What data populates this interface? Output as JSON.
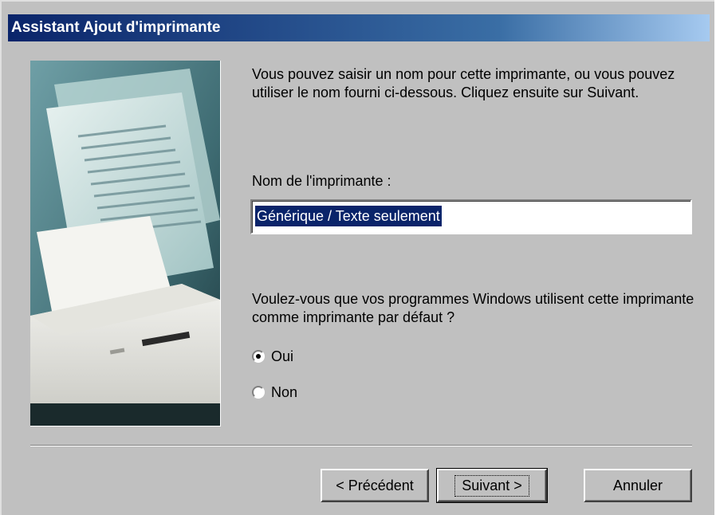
{
  "window": {
    "title": "Assistant Ajout d'imprimante"
  },
  "wizard": {
    "intro": "Vous pouvez saisir un nom pour cette imprimante, ou vous pouvez utiliser le nom fourni ci-dessous. Cliquez ensuite sur Suivant.",
    "printer_name_label": "Nom de l'imprimante :",
    "printer_name_value": "Générique / Texte seulement",
    "default_question": "Voulez-vous que vos programmes Windows utilisent cette imprimante comme imprimante par défaut ?",
    "options": [
      {
        "label": "Oui",
        "selected": true
      },
      {
        "label": "Non",
        "selected": false
      }
    ]
  },
  "buttons": {
    "back": "< Précédent",
    "next": "Suivant >",
    "cancel": "Annuler"
  },
  "colors": {
    "dialog_bg": "#c0c0c0",
    "titlebar_start": "#0a246a",
    "titlebar_end": "#a6caf0",
    "selection": "#0a246a"
  }
}
